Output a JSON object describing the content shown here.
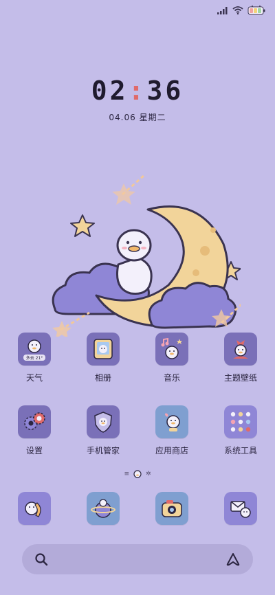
{
  "clock": {
    "hours": "02",
    "separator": ":",
    "minutes": "36"
  },
  "date": {
    "day": "04.06",
    "weekday": "星期二"
  },
  "apps_row1": [
    {
      "label": "天气",
      "icon": "weather-icon",
      "icon_text": "多云 21°"
    },
    {
      "label": "相册",
      "icon": "gallery-icon"
    },
    {
      "label": "音乐",
      "icon": "music-icon"
    },
    {
      "label": "主题壁纸",
      "icon": "theme-icon"
    }
  ],
  "apps_row2": [
    {
      "label": "设置",
      "icon": "settings-gear-icon"
    },
    {
      "label": "手机管家",
      "icon": "shield-icon"
    },
    {
      "label": "应用商店",
      "icon": "app-store-icon"
    },
    {
      "label": "系统工具",
      "icon": "tools-folder-icon"
    }
  ],
  "dock": [
    {
      "icon": "phone-icon"
    },
    {
      "icon": "browser-planet-icon"
    },
    {
      "icon": "camera-icon"
    },
    {
      "icon": "messages-envelope-icon"
    }
  ],
  "search": {
    "left_icon": "search-icon",
    "right_icon": "assistant-icon"
  },
  "colors": {
    "background": "#c4bde9",
    "icon_tile": "#7a70b8",
    "moon": "#f2d49a",
    "cloud": "#8f86d6"
  }
}
